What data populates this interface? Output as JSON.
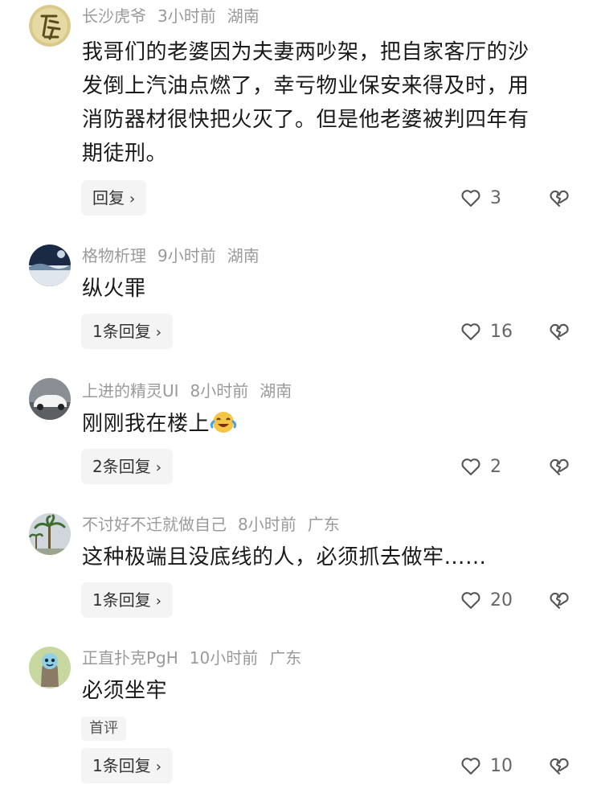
{
  "comments": [
    {
      "username": "长沙虎爷",
      "time": "3小时前",
      "location": "湖南",
      "lines": [
        "我哥们的老婆因为夫妻两吵架，把自家客厅的沙",
        "发倒上汽油点燃了，幸亏物业保安来得及时，用",
        "消防器材很快把火灭了。但是他老婆被判四年有",
        "期徒刑。"
      ],
      "reply_label": "回复",
      "likes": "3"
    },
    {
      "username": "格物析理",
      "time": "9小时前",
      "location": "湖南",
      "lines": [
        "纵火罪"
      ],
      "reply_label": "1条回复",
      "likes": "16"
    },
    {
      "username": "上进的精灵UI",
      "time": "8小时前",
      "location": "湖南",
      "lines": [
        "刚刚我在楼上"
      ],
      "reply_label": "2条回复",
      "likes": "2"
    },
    {
      "username": "不讨好不迁就做自己",
      "time": "8小时前",
      "location": "广东",
      "lines": [
        "这种极端且没底线的人，必须抓去做牢……"
      ],
      "reply_label": "1条回复",
      "likes": "20"
    },
    {
      "username": "正直扑克PgH",
      "time": "10小时前",
      "location": "广东",
      "lines": [
        "必须坐牢"
      ],
      "badge": "首评",
      "reply_label": "1条回复",
      "likes": "10"
    }
  ],
  "icons": {
    "reply_chevron": "chevron-right-icon",
    "like": "heart-outline-icon",
    "dislike": "broken-heart-icon",
    "emoji": "laughing-crying-emoji-icon"
  },
  "colors": {
    "meta_text": "#9a9a9a",
    "body_text": "#1a1a1a",
    "button_bg": "#f4f4f4",
    "avatar1_bg": "#d9c98a"
  }
}
